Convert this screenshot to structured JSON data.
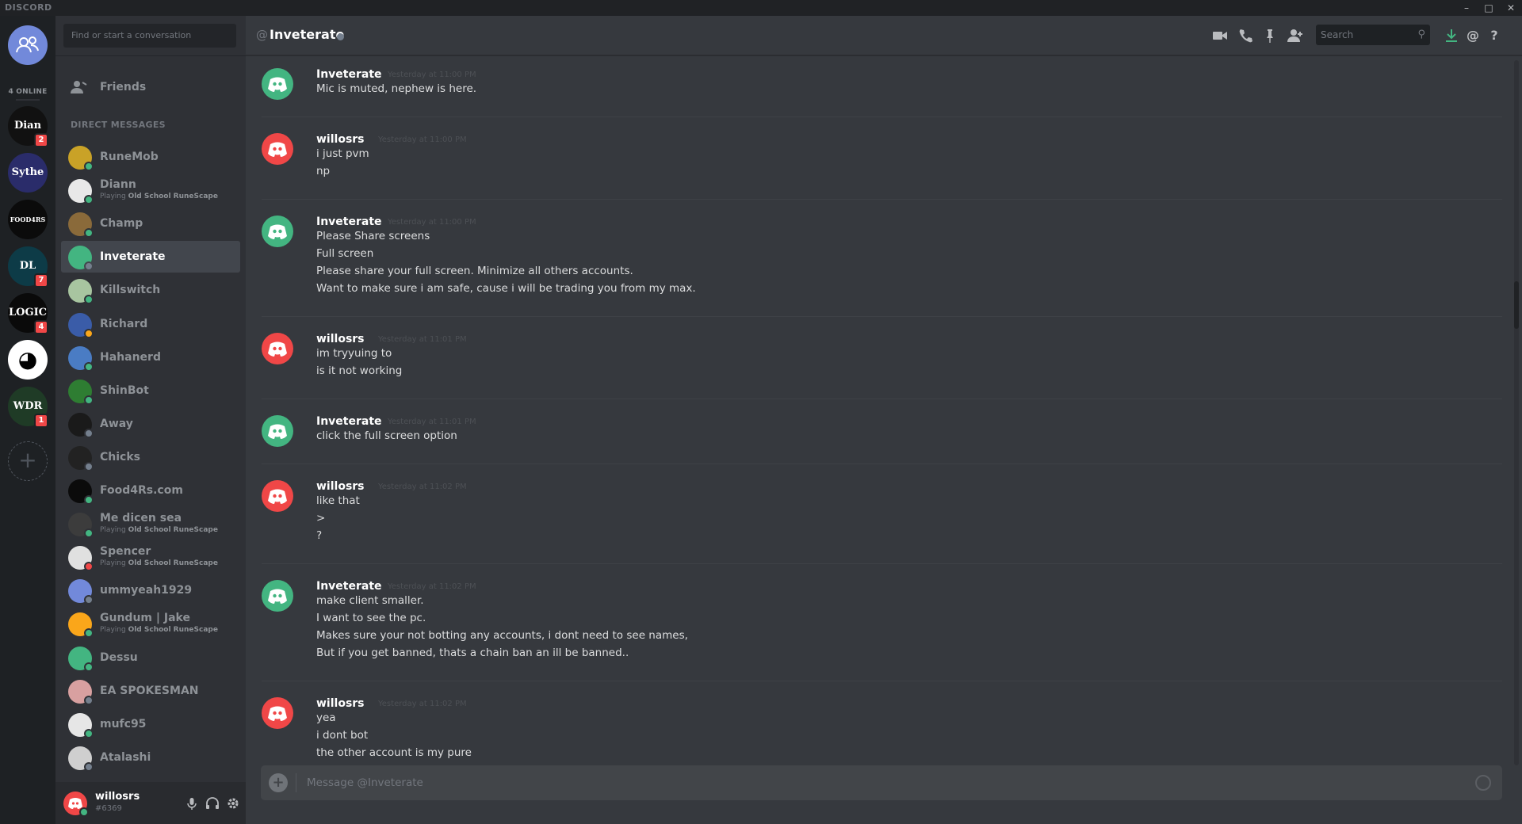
{
  "titlebar": {
    "brand": "DISCORD",
    "controls": [
      "–",
      "□",
      "✕"
    ]
  },
  "guilds": {
    "online_label": "4 ONLINE",
    "servers": [
      {
        "name": "Diann",
        "glyph": "Dian",
        "badge": "2",
        "bg": "#111111"
      },
      {
        "name": "Sythe",
        "glyph": "Sythe",
        "badge": "",
        "bg": "#2a2c6a"
      },
      {
        "name": "Food4Rs",
        "glyph": "FOOD4RS",
        "badge": "",
        "bg": "#0b0b0b"
      },
      {
        "name": "DL",
        "glyph": "DL",
        "badge": "7",
        "bg": "#0d3b47"
      },
      {
        "name": "Logic",
        "glyph": "LOGIC",
        "badge": "4",
        "bg": "#0a0a0a"
      },
      {
        "name": "Panda",
        "glyph": "◕",
        "badge": "",
        "bg": "#ffffff"
      },
      {
        "name": "WDR",
        "glyph": "WDR",
        "badge": "1",
        "bg": "#1f3b26"
      }
    ],
    "add_label": "+"
  },
  "dm_sidebar": {
    "search_placeholder": "Find or start a conversation",
    "friends_label": "Friends",
    "heading": "DIRECT MESSAGES",
    "items": [
      {
        "name": "RuneMob",
        "status": "online",
        "av": "#c9a227",
        "sub_prefix": "",
        "sub_game": ""
      },
      {
        "name": "Diann",
        "status": "online",
        "av": "#e8e8e8",
        "sub_prefix": "Playing ",
        "sub_game": "Old School RuneScape"
      },
      {
        "name": "Champ",
        "status": "online",
        "av": "#8a6a3a",
        "sub_prefix": "",
        "sub_game": ""
      },
      {
        "name": "Inveterate",
        "status": "offline",
        "av": "#43b581",
        "sub_prefix": "",
        "sub_game": ""
      },
      {
        "name": "Killswitch",
        "status": "online",
        "av": "#a8c5a0",
        "sub_prefix": "",
        "sub_game": ""
      },
      {
        "name": "Richard",
        "status": "idle",
        "av": "#3a5ca8",
        "sub_prefix": "",
        "sub_game": ""
      },
      {
        "name": "Hahanerd",
        "status": "online",
        "av": "#4a7cc4",
        "sub_prefix": "",
        "sub_game": ""
      },
      {
        "name": "ShinBot",
        "status": "online",
        "av": "#2e7d32",
        "sub_prefix": "",
        "sub_game": ""
      },
      {
        "name": "Away",
        "status": "offline",
        "av": "#1a1a1a",
        "sub_prefix": "",
        "sub_game": ""
      },
      {
        "name": "Chicks",
        "status": "offline",
        "av": "#222222",
        "sub_prefix": "",
        "sub_game": ""
      },
      {
        "name": "Food4Rs.com",
        "status": "online",
        "av": "#0b0b0b",
        "sub_prefix": "",
        "sub_game": ""
      },
      {
        "name": "Me dicen sea",
        "status": "online",
        "av": "#3c3c3c",
        "sub_prefix": "Playing ",
        "sub_game": "Old School RuneScape"
      },
      {
        "name": "Spencer",
        "status": "dnd",
        "av": "#e0e0e0",
        "sub_prefix": "Playing ",
        "sub_game": "Old School RuneScape"
      },
      {
        "name": "ummyeah1929",
        "status": "offline",
        "av": "#7289da",
        "sub_prefix": "",
        "sub_game": ""
      },
      {
        "name": "Gundum | Jake",
        "status": "online",
        "av": "#faa61a",
        "sub_prefix": "Playing ",
        "sub_game": "Old School RuneScape"
      },
      {
        "name": "Dessu",
        "status": "online",
        "av": "#43b581",
        "sub_prefix": "",
        "sub_game": ""
      },
      {
        "name": "EA SPOKESMAN",
        "status": "offline",
        "av": "#d8a0a0",
        "sub_prefix": "",
        "sub_game": ""
      },
      {
        "name": "mufc95",
        "status": "online",
        "av": "#e6e6e6",
        "sub_prefix": "",
        "sub_game": ""
      },
      {
        "name": "Atalashi",
        "status": "offline",
        "av": "#cfcfcf",
        "sub_prefix": "",
        "sub_game": ""
      }
    ]
  },
  "user": {
    "name": "willosrs",
    "tag": "#6369"
  },
  "chat": {
    "at_symbol": "@",
    "title": "Inveterate",
    "search_placeholder": "Search",
    "composer_placeholder": "Message @Inveterate",
    "groups": [
      {
        "author": "Inveterate",
        "color": "green",
        "ts": "Yesterday at 11:00 PM",
        "lines": [
          "Mic is muted, nephew is here."
        ]
      },
      {
        "author": "willosrs",
        "color": "red",
        "ts": "Yesterday at 11:00 PM",
        "lines": [
          "i just pvm",
          "np"
        ]
      },
      {
        "author": "Inveterate",
        "color": "green",
        "ts": "Yesterday at 11:00 PM",
        "lines": [
          "Please Share screens",
          "Full screen",
          "Please share your full screen. Minimize all others accounts.",
          "Want to make sure i am safe, cause i will be trading you from my max."
        ]
      },
      {
        "author": "willosrs",
        "color": "red",
        "ts": "Yesterday at 11:01 PM",
        "lines": [
          "im tryyuing to",
          "is it not working"
        ]
      },
      {
        "author": "Inveterate",
        "color": "green",
        "ts": "Yesterday at 11:01 PM",
        "lines": [
          "click the full screen option"
        ]
      },
      {
        "author": "willosrs",
        "color": "red",
        "ts": "Yesterday at 11:02 PM",
        "lines": [
          "like that",
          ">",
          "?"
        ]
      },
      {
        "author": "Inveterate",
        "color": "green",
        "ts": "Yesterday at 11:02 PM",
        "lines": [
          "make client smaller.",
          "I want to see the pc.",
          "Makes sure your not botting any accounts, i dont need to see names,",
          "But if you get banned, thats a chain ban an ill be banned.."
        ]
      },
      {
        "author": "willosrs",
        "color": "red",
        "ts": "Yesterday at 11:02 PM",
        "lines": [
          "yea",
          "i dont bot",
          "the other account is my pure"
        ]
      }
    ]
  }
}
